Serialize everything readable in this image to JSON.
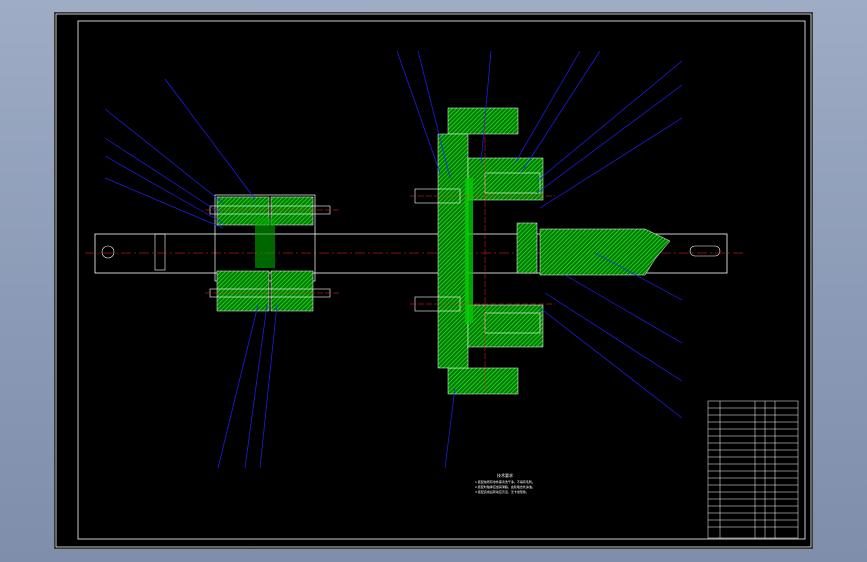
{
  "drawing": {
    "notes": {
      "title": "技术要求",
      "lines": [
        "1.装配前所有零件需清洗干净，不得有毛刺。",
        "2.装配时轴承应加润滑脂，齿轮啮合处涂油。",
        "3.装配完成后转动应灵活，无卡滞现象。"
      ]
    },
    "colors": {
      "sheet": "#000000",
      "outline": "#ffffff",
      "hatch": "#00c000",
      "centerline": "#ff2020",
      "leader": "#2020ff",
      "table_line": "#ffffff"
    }
  }
}
